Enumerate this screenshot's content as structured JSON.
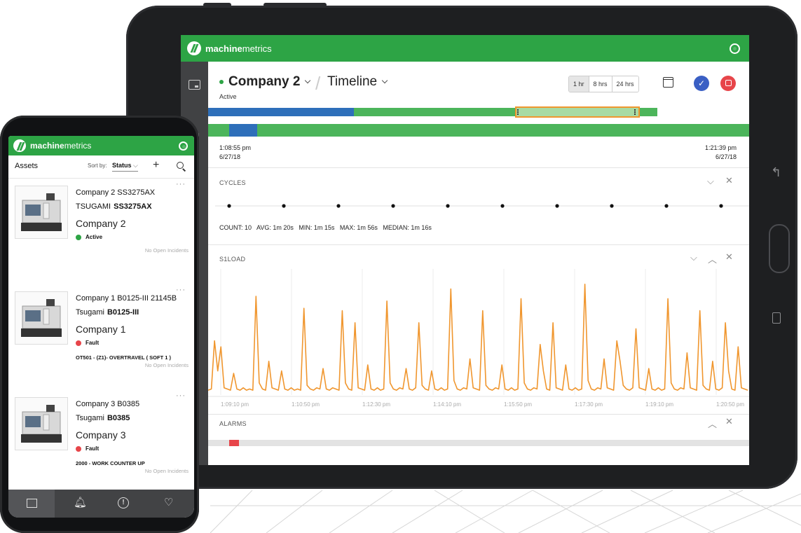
{
  "brand": {
    "bold": "machine",
    "light": "metrics"
  },
  "tablet": {
    "company_title": "Company 2",
    "view_title": "Timeline",
    "status_label": "Active",
    "ranges": [
      "1 hr",
      "8 hrs",
      "24 hrs"
    ],
    "start_time": "1:08:55 pm",
    "start_date": "6/27/18",
    "end_time": "1:21:39 pm",
    "end_date": "6/27/18",
    "cycles_title": "CYCLES",
    "cycles_stats": "COUNT: 10   AVG: 1m 20s   MIN: 1m 15s   MAX: 1m 56s   MEDIAN: 1m 16s",
    "s1load_title": "S1LOAD",
    "alarms_title": "ALARMS",
    "colors": {
      "accent": "#2da445",
      "blue": "#2e6fba",
      "orange": "#f0962e",
      "red": "#e7454a"
    }
  },
  "chart_data": {
    "type": "line",
    "title": "S1LOAD",
    "x_tick_labels": [
      "1:09:10 pm",
      "1:10:50 pm",
      "1:12:30 pm",
      "1:14:10 pm",
      "1:15:50 pm",
      "1:17:30 pm",
      "1:19:10 pm",
      "1:20:50 pm"
    ],
    "series": [
      {
        "color": "#f0962e",
        "values": [
          4,
          5,
          45,
          20,
          40,
          6,
          5,
          4,
          18,
          5,
          4,
          6,
          4,
          5,
          4,
          82,
          10,
          5,
          4,
          28,
          6,
          5,
          4,
          20,
          5,
          4,
          6,
          4,
          5,
          4,
          72,
          8,
          5,
          4,
          6,
          5,
          22,
          5,
          4,
          6,
          5,
          4,
          70,
          10,
          5,
          4,
          60,
          6,
          5,
          4,
          25,
          5,
          4,
          6,
          4,
          5,
          78,
          10,
          5,
          4,
          6,
          5,
          22,
          5,
          4,
          6,
          60,
          8,
          5,
          4,
          20,
          5,
          4,
          6,
          4,
          5,
          88,
          12,
          5,
          4,
          6,
          5,
          30,
          6,
          5,
          4,
          70,
          8,
          5,
          4,
          6,
          5,
          25,
          5,
          4,
          6,
          4,
          5,
          80,
          10,
          5,
          4,
          6,
          5,
          42,
          20,
          5,
          4,
          60,
          6,
          5,
          4,
          25,
          5,
          4,
          6,
          4,
          5,
          92,
          12,
          5,
          4,
          6,
          5,
          30,
          6,
          5,
          4,
          45,
          28,
          8,
          5,
          4,
          6,
          55,
          6,
          5,
          4,
          22,
          5,
          4,
          6,
          4,
          5,
          80,
          10,
          5,
          4,
          6,
          5,
          35,
          6,
          5,
          4,
          70,
          8,
          5,
          4,
          28,
          5,
          4,
          6,
          60,
          20,
          5,
          4,
          40,
          6,
          5,
          4
        ]
      }
    ],
    "cycle_points": 10
  },
  "phone": {
    "assets_label": "Assets",
    "sort_by_label": "Sort by:",
    "sort_value": "Status",
    "cards": [
      {
        "name": "Company 2 SS3275AX",
        "maker": "TSUGAMI",
        "model": "SS3275AX",
        "company": "Company 2",
        "status": "Active",
        "status_color": "#2da445",
        "alarm": "",
        "incidents": "No Open Incidents"
      },
      {
        "name": "Company 1 B0125-III 21145B",
        "maker": "Tsugami",
        "model": "B0125-III",
        "company": "Company 1",
        "status": "Fault",
        "status_color": "#e7454a",
        "alarm": "OT501 - (Z1)- OVERTRAVEL ( SOFT 1 )",
        "incidents": "No Open Incidents"
      },
      {
        "name": "Company 3 B0385",
        "maker": "Tsugami",
        "model": "B0385",
        "company": "Company 3",
        "status": "Fault",
        "status_color": "#e7454a",
        "alarm": "2000 - WORK COUNTER UP",
        "incidents": "No Open Incidents"
      }
    ],
    "tabs": [
      "assets-icon",
      "bell-icon",
      "alert-icon",
      "heartbeat-icon"
    ]
  }
}
